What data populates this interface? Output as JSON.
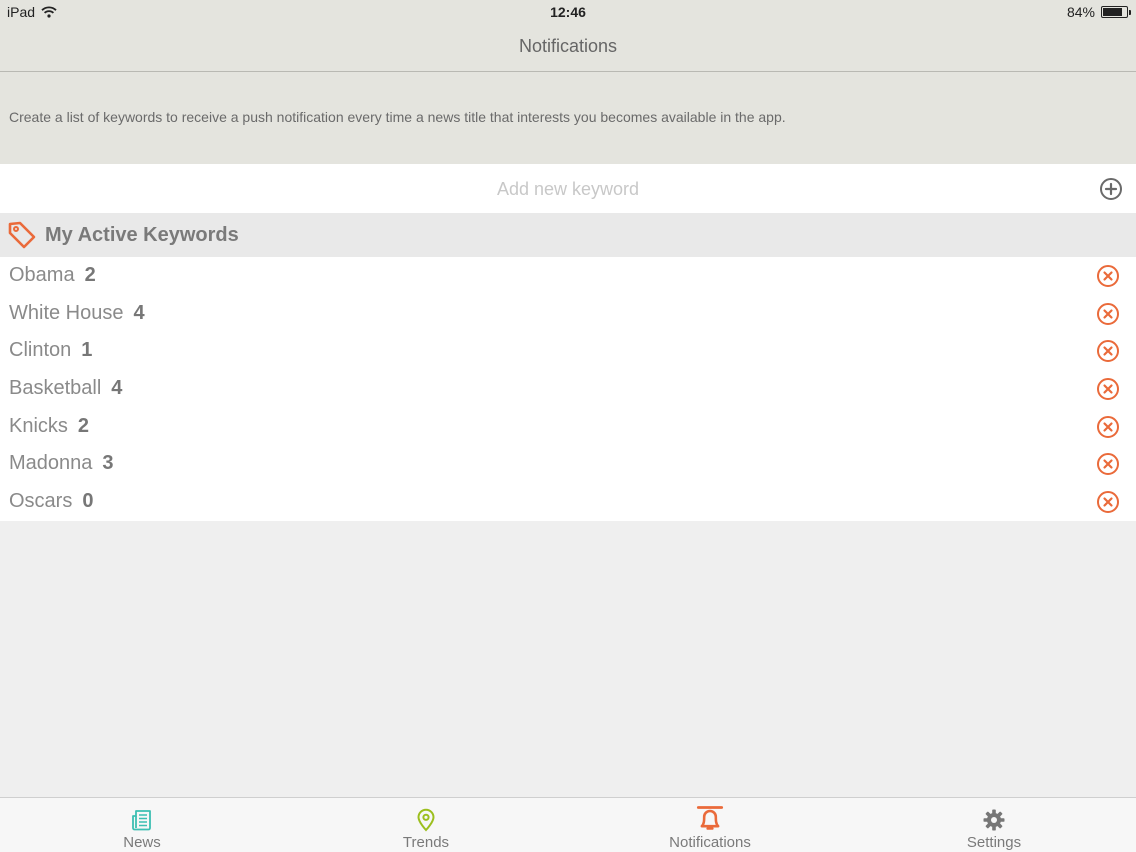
{
  "status_bar": {
    "device": "iPad",
    "time": "12:46",
    "battery": "84%",
    "battery_level": 0.84
  },
  "nav": {
    "title": "Notifications"
  },
  "description": "Create a list of keywords to receive a push notification every time a news title that interests you becomes available in the app.",
  "add_keyword": {
    "placeholder": "Add new keyword",
    "icon": "plus-circle-icon"
  },
  "section": {
    "title": "My Active Keywords",
    "icon": "tag-icon"
  },
  "keywords": [
    {
      "name": "Obama",
      "count": "2"
    },
    {
      "name": "White House",
      "count": "4"
    },
    {
      "name": "Clinton",
      "count": "1"
    },
    {
      "name": "Basketball",
      "count": "4"
    },
    {
      "name": "Knicks",
      "count": "2"
    },
    {
      "name": "Madonna",
      "count": "3"
    },
    {
      "name": "Oscars",
      "count": "0"
    }
  ],
  "tabs": [
    {
      "label": "News",
      "icon": "newspaper-icon",
      "color": "#3cbfb2"
    },
    {
      "label": "Trends",
      "icon": "map-pin-icon",
      "color": "#9cbf1e"
    },
    {
      "label": "Notifications",
      "icon": "bell-icon",
      "color": "#ea6a3a",
      "active": true
    },
    {
      "label": "Settings",
      "icon": "gear-icon",
      "color": "#777777"
    }
  ],
  "colors": {
    "accent": "#ea6a3a",
    "header_bg": "#e4e4de",
    "section_bg": "#e9e9e9"
  }
}
